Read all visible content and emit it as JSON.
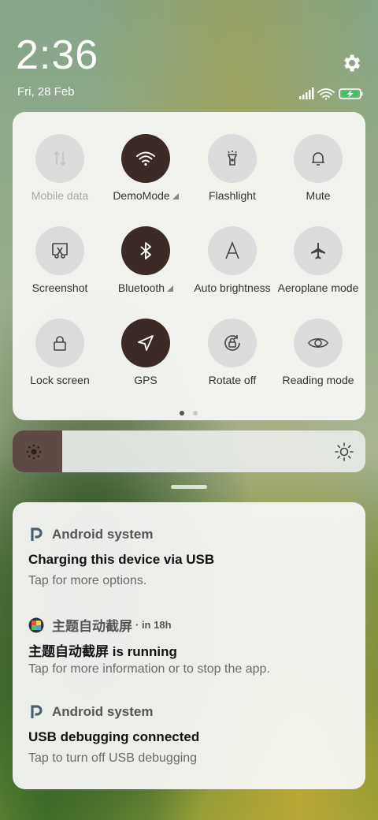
{
  "status": {
    "time": "2:36",
    "date": "Fri, 28 Feb",
    "icons": [
      "signal-icon",
      "wifi-icon",
      "battery-charging-icon"
    ],
    "battery_color": "#34c759"
  },
  "quick_settings": {
    "tiles": [
      {
        "label": "Mobile data",
        "icon": "mobile-data-icon",
        "active": false,
        "disabled": true
      },
      {
        "label": "DemoMode",
        "icon": "wifi-icon",
        "active": true,
        "has_menu": true
      },
      {
        "label": "Flashlight",
        "icon": "flashlight-icon",
        "active": false
      },
      {
        "label": "Mute",
        "icon": "bell-icon",
        "active": false
      },
      {
        "label": "Screenshot",
        "icon": "screenshot-icon",
        "active": false
      },
      {
        "label": "Bluetooth",
        "icon": "bluetooth-icon",
        "active": true,
        "has_menu": true
      },
      {
        "label": "Auto brightness",
        "icon": "auto-brightness-icon",
        "active": false
      },
      {
        "label": "Aeroplane mode",
        "icon": "airplane-icon",
        "active": false
      },
      {
        "label": "Lock screen",
        "icon": "lock-icon",
        "active": false
      },
      {
        "label": "GPS",
        "icon": "location-icon",
        "active": true
      },
      {
        "label": "Rotate off",
        "icon": "rotate-lock-icon",
        "active": false
      },
      {
        "label": "Reading mode",
        "icon": "eye-icon",
        "active": false
      }
    ],
    "page_indicator": {
      "pages": 2,
      "current": 1
    },
    "active_color": "#3b2a25"
  },
  "brightness": {
    "level": 0.14
  },
  "notifications": [
    {
      "app": "Android system",
      "icon": "android-system-icon",
      "time": "",
      "title": "Charging this device via USB",
      "text": "Tap for more options."
    },
    {
      "app": "主题自动截屏",
      "icon": "app-icon",
      "time": "· in 18h",
      "title": "主题自动截屏 is running",
      "text": "Tap for more information or to stop the app."
    },
    {
      "app": "Android system",
      "icon": "android-system-icon",
      "time": "",
      "title": "USB debugging connected",
      "text": "Tap to turn off USB debugging"
    }
  ]
}
